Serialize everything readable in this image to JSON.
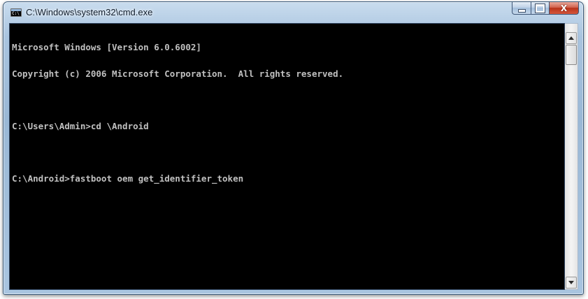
{
  "window": {
    "title": "C:\\Windows\\system32\\cmd.exe",
    "icon": "command-prompt-icon",
    "controls": {
      "minimize": "minimize-icon",
      "maximize": "maximize-icon",
      "close_label": "X"
    }
  },
  "console": {
    "lines": [
      "Microsoft Windows [Version 6.0.6002]",
      "Copyright (c) 2006 Microsoft Corporation.  All rights reserved.",
      "",
      "C:\\Users\\Admin>cd \\Android",
      "",
      "C:\\Android>fastboot oem get_identifier_token"
    ],
    "text_color": "#c0c0c0",
    "background_color": "#000000"
  },
  "scrollbar": {
    "position_fraction": 0
  },
  "colors": {
    "frame": "#a9c4df",
    "close_button": "#c43c20"
  }
}
